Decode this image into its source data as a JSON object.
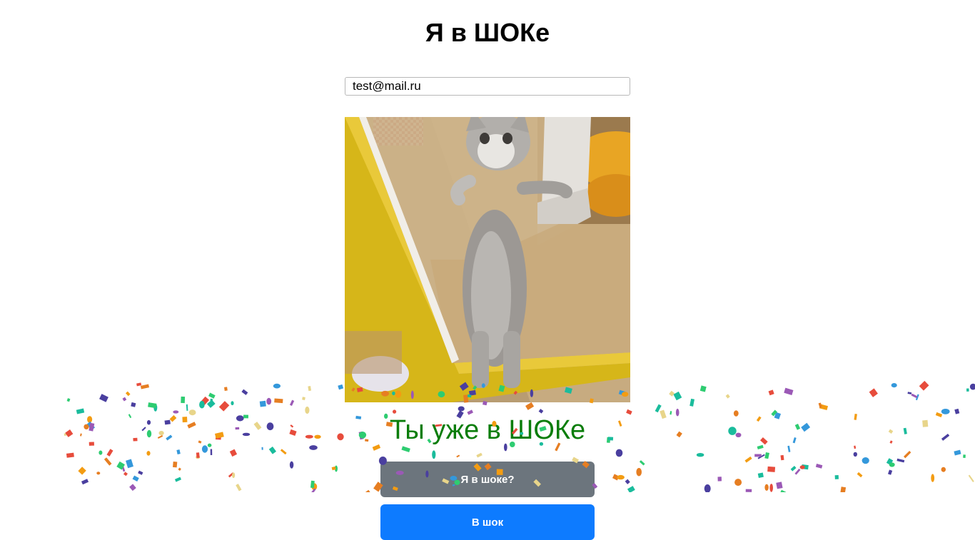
{
  "header": {
    "title": "Я в ШОКе"
  },
  "form": {
    "email_value": "test@mail.ru"
  },
  "image": {
    "icon": "cat-photo"
  },
  "status": {
    "message": "Ты уже в ШОКе",
    "color": "#0a7d0a"
  },
  "buttons": {
    "check_label": "Я в шоке?",
    "check_color": "#6c757d",
    "shock_label": "В шок",
    "shock_color": "#0d7bff"
  },
  "confetti_colors": [
    "#4a3f9f",
    "#2ecc71",
    "#e74c3c",
    "#f39c12",
    "#9b59b6",
    "#3498db",
    "#e8d58a",
    "#1abc9c",
    "#e67e22"
  ]
}
